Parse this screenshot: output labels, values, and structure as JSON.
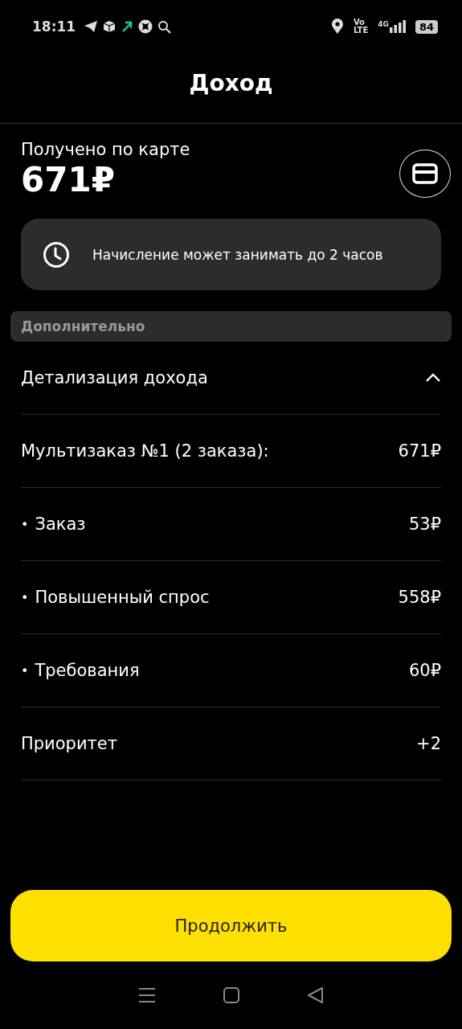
{
  "status_bar": {
    "time": "18:11",
    "volte_top": "Vo",
    "volte_bottom": "LTE",
    "network": "4G",
    "battery": "84"
  },
  "header": {
    "title": "Доход"
  },
  "received": {
    "label": "Получено по карте",
    "amount": "671₽"
  },
  "notice": {
    "text": "Начисление может занимать до 2 часов"
  },
  "section": {
    "title": "Дополнительно"
  },
  "details": {
    "title": "Детализация дохода",
    "expanded": true,
    "rows": [
      {
        "kind": "plain",
        "label": "Мультизаказ №1 (2 заказа):",
        "value": "671₽"
      },
      {
        "kind": "bullet",
        "bullet": "•",
        "label": "Заказ",
        "value": "53₽"
      },
      {
        "kind": "bullet",
        "bullet": "•",
        "label": "Повышенный спрос",
        "value": "558₽"
      },
      {
        "kind": "bullet",
        "bullet": "•",
        "label": "Требования",
        "value": "60₽"
      },
      {
        "kind": "plain",
        "label": "Приоритет",
        "value": "+2"
      }
    ]
  },
  "continue_button": {
    "label": "Продолжить"
  }
}
